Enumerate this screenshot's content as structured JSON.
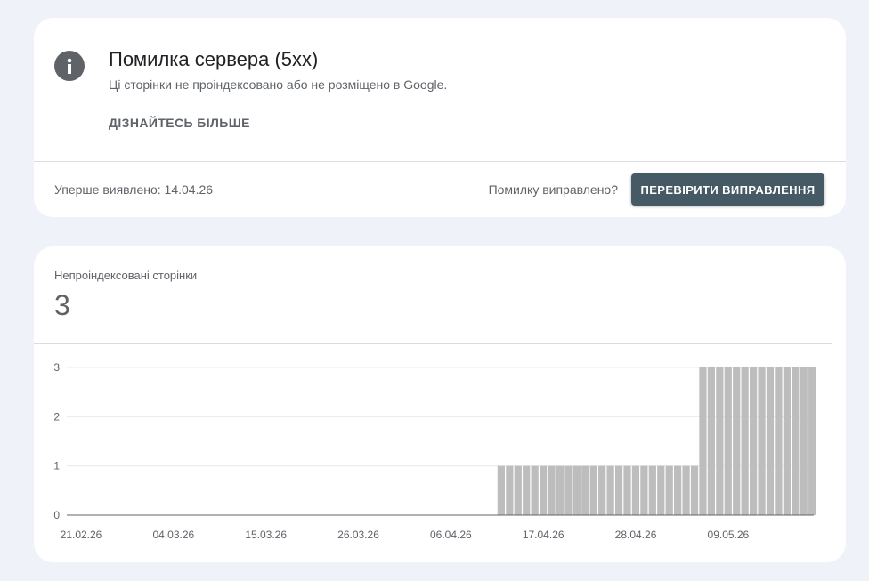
{
  "issue": {
    "icon": "info-icon",
    "title": "Помилка сервера (5xx)",
    "description": "Ці сторінки не проіндексовано або не розміщено в Google.",
    "learn_more": "ДІЗНАЙТЕСЬ БІЛЬШЕ",
    "first_detected": "Уперше виявлено: 14.04.26",
    "fixed_question": "Помилку виправлено?",
    "validate_button": "ПЕРЕВІРИТИ ВИПРАВЛЕННЯ"
  },
  "metric": {
    "label": "Непроіндексовані сторінки",
    "value": "3"
  },
  "colors": {
    "bar": "#bdbdbd",
    "button": "#455a64",
    "grid": "#e8eaed"
  },
  "chart_data": {
    "type": "bar",
    "title": "",
    "xlabel": "",
    "ylabel": "",
    "ylim": [
      0,
      3
    ],
    "y_ticks": [
      "0",
      "1",
      "2",
      "3"
    ],
    "x_tick_labels": [
      "21.02.26",
      "04.03.26",
      "15.03.26",
      "26.03.26",
      "06.04.26",
      "17.04.26",
      "28.04.26",
      "09.05.26"
    ],
    "x_tick_days": [
      0,
      11,
      22,
      33,
      44,
      55,
      66,
      77
    ],
    "bar_start_day": 50,
    "values": [
      1,
      1,
      1,
      1,
      1,
      1,
      1,
      1,
      1,
      1,
      1,
      1,
      1,
      1,
      1,
      1,
      1,
      1,
      1,
      1,
      1,
      1,
      1,
      1,
      3,
      3,
      3,
      3,
      3,
      3,
      3,
      3,
      3,
      3,
      3,
      3,
      3,
      3
    ]
  }
}
